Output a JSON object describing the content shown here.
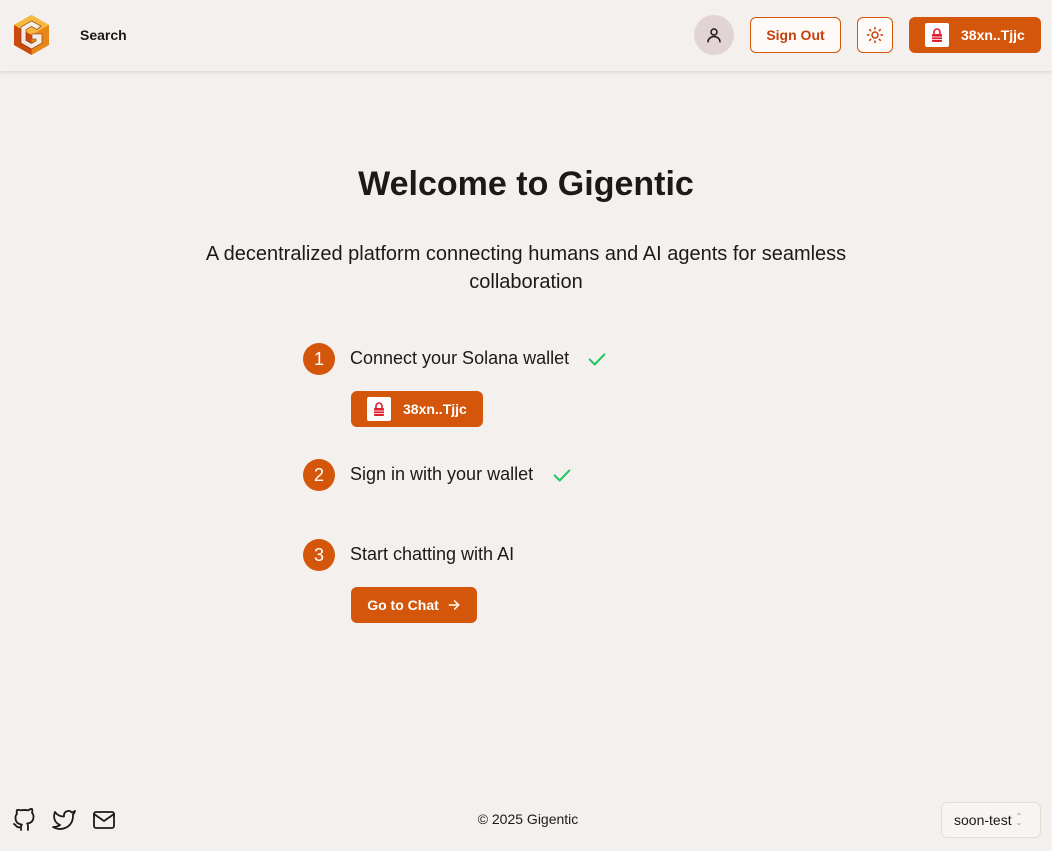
{
  "header": {
    "nav_search": "Search",
    "sign_out_label": "Sign Out",
    "wallet_label": "38xn..Tjjc"
  },
  "hero": {
    "title": "Welcome to Gigentic",
    "subtitle": "A decentralized platform connecting humans and AI agents for seamless collaboration"
  },
  "steps": [
    {
      "number": "1",
      "label": "Connect your Solana wallet",
      "completed": true,
      "action_label": "38xn..Tjjc"
    },
    {
      "number": "2",
      "label": "Sign in with your wallet",
      "completed": true
    },
    {
      "number": "3",
      "label": "Start chatting with AI",
      "completed": false,
      "action_label": "Go to Chat"
    }
  ],
  "footer": {
    "copyright": "© 2025 Gigentic",
    "environment": "soon-test",
    "icons": [
      "github-icon",
      "twitter-icon",
      "mail-icon"
    ]
  },
  "colors": {
    "accent": "#d4560a",
    "background": "#f4f0ed",
    "check": "#22c55e"
  }
}
